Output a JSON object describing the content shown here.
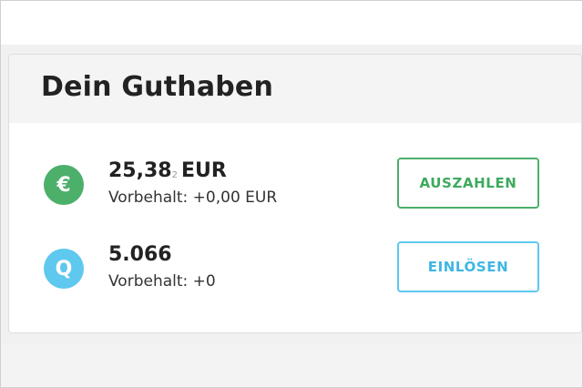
{
  "balance": {
    "title": "Dein Guthaben",
    "accounts": [
      {
        "icon": "euro-icon",
        "icon_glyph": "€",
        "amount_main": "25,38",
        "amount_sub": "2",
        "currency": "EUR",
        "reserve": "Vorbehalt: +0,00 EUR",
        "action_label": "AUSZAHLEN"
      },
      {
        "icon": "q-points-icon",
        "icon_glyph": "Q",
        "amount_main": "5.066",
        "reserve": "Vorbehalt: +0",
        "action_label": "EINLÖSEN"
      }
    ]
  },
  "colors": {
    "green": "#4caf6a",
    "blue": "#5ec8ee",
    "text": "#222222"
  }
}
